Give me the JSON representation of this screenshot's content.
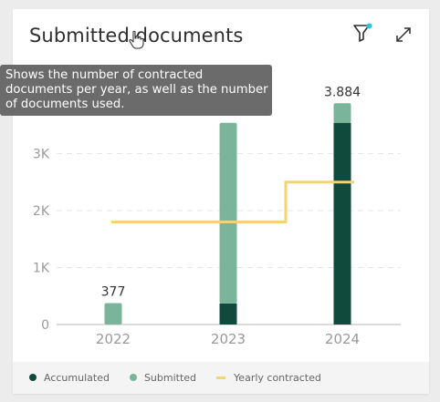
{
  "widget": {
    "title": "Submitted documents",
    "tooltip_lines": [
      "Shows the number of contracted",
      "documents per year, as well as the number",
      "of documents used."
    ],
    "filter_icon": "filter-icon",
    "expand_icon": "expand-icon",
    "filter_badge_color": "#2ec4e0"
  },
  "colors": {
    "accumulated": "#0f4a3c",
    "submitted": "#7ab59b",
    "yearly_contracted": "#f2d27a",
    "axis_text": "#9a9a9a",
    "grid": "#e6e6e6"
  },
  "chart_data": {
    "type": "bar",
    "stacked": true,
    "categories": [
      "2022",
      "2023",
      "2024"
    ],
    "series": [
      {
        "name": "Accumulated",
        "kind": "bar",
        "values": [
          0,
          370,
          3541
        ]
      },
      {
        "name": "Submitted",
        "kind": "bar",
        "values": [
          377,
          3171,
          343
        ]
      },
      {
        "name": "Yearly contracted",
        "kind": "step-line",
        "values": [
          1800,
          1800,
          2500
        ]
      }
    ],
    "totals": [
      "377",
      "3.541",
      "3.884"
    ],
    "y_ticks": [
      "0",
      "1K",
      "2K",
      "3K"
    ],
    "ylim": [
      0,
      4000
    ],
    "grid": true,
    "legend_position": "bottom-left"
  }
}
